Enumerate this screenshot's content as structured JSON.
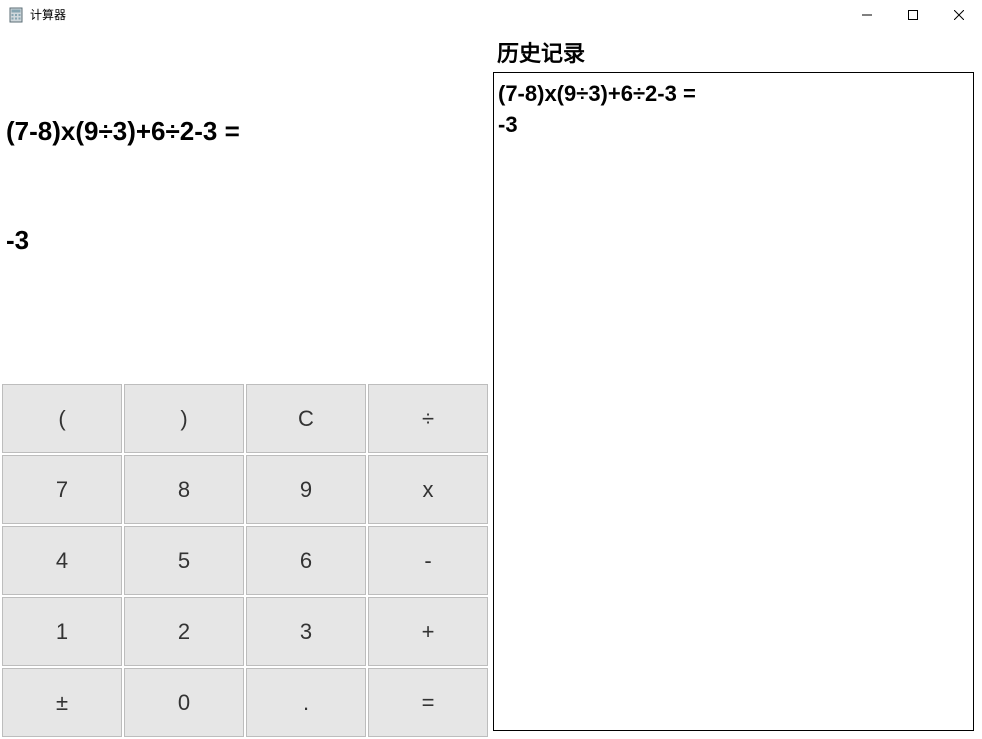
{
  "window": {
    "title": "计算器"
  },
  "display": {
    "line1": "(7-8)x(9÷3)+6÷2-3 =",
    "line2": "-3"
  },
  "keypad": {
    "rows": [
      [
        "(",
        ")",
        "C",
        "÷"
      ],
      [
        "7",
        "8",
        "9",
        "x"
      ],
      [
        "4",
        "5",
        "6",
        "-"
      ],
      [
        "1",
        "2",
        "3",
        "+"
      ],
      [
        "±",
        "0",
        ".",
        "="
      ]
    ]
  },
  "history": {
    "title": "历史记录",
    "entries": [
      "(7-8)x(9÷3)+6÷2-3 =\n-3"
    ]
  }
}
